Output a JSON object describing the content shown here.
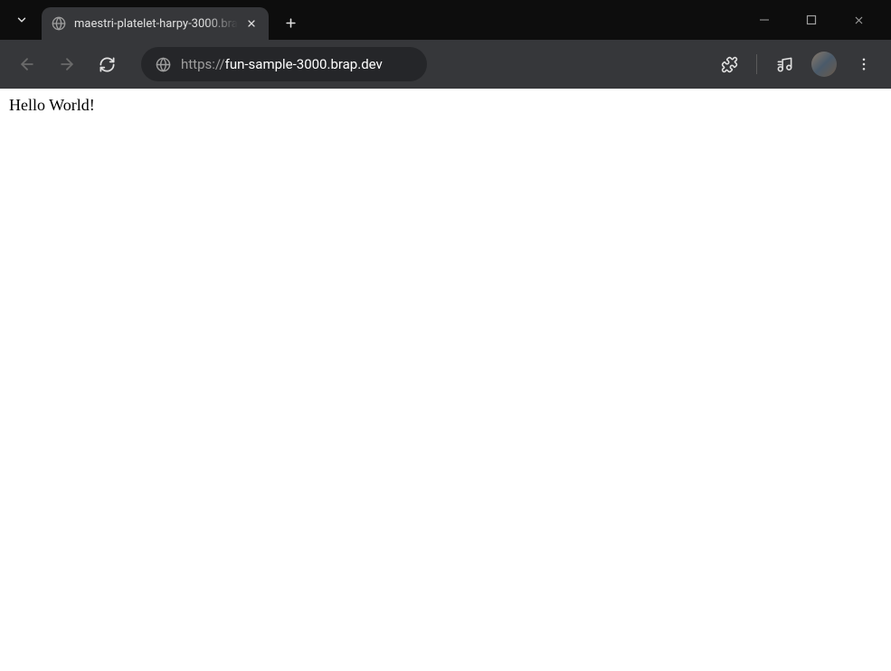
{
  "tab": {
    "title": "maestri-platelet-harpy-3000.bra"
  },
  "address": {
    "protocol": "https://",
    "domain": "fun-sample-3000.brap.dev"
  },
  "page": {
    "content": "Hello World!"
  }
}
